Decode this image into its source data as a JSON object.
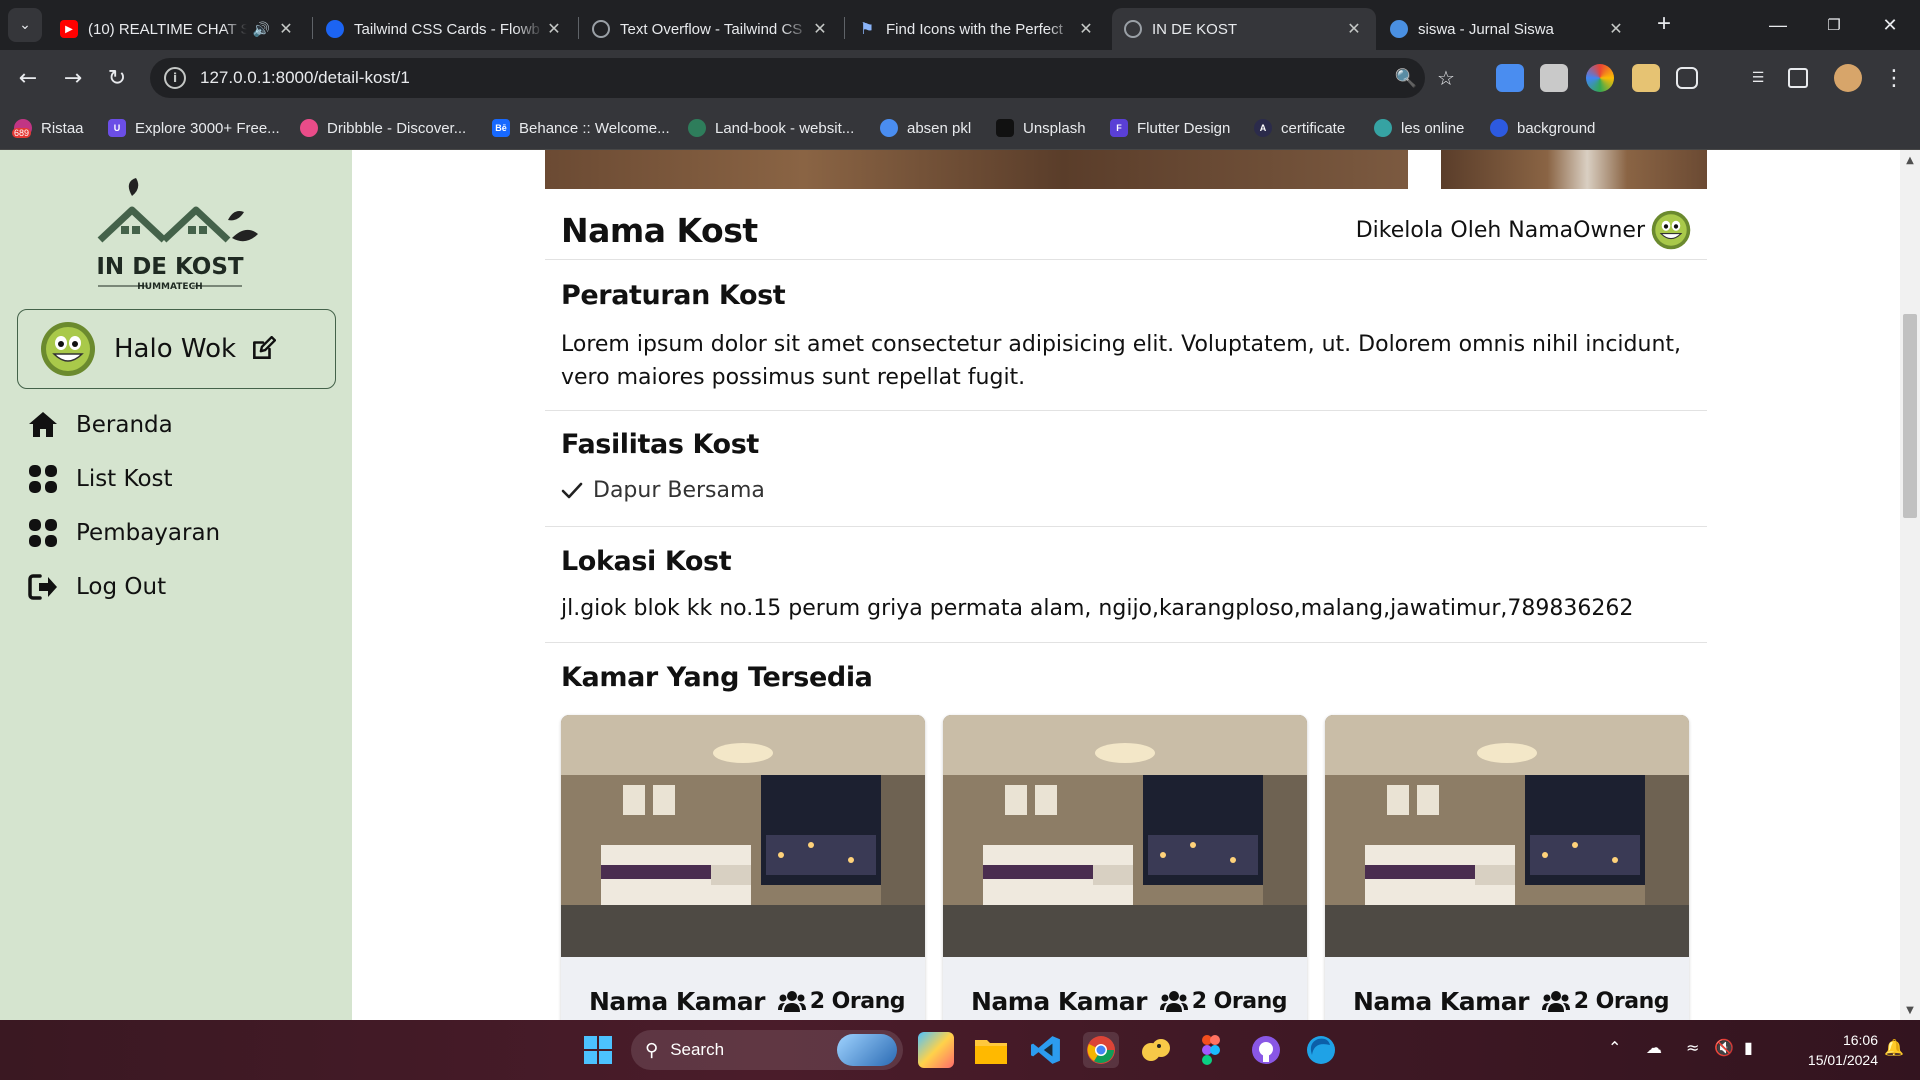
{
  "browser": {
    "tabs": [
      {
        "title": "(10) REALTIME CHAT S",
        "color": "#ff0000"
      },
      {
        "title": "Tailwind CSS Cards - Flowb",
        "color": "#1c64f2"
      },
      {
        "title": "Text Overflow - Tailwind CS",
        "color": "#9aa0a6"
      },
      {
        "title": "Find Icons with the Perfect",
        "color": "#8ab4f8"
      },
      {
        "title": "IN DE KOST",
        "color": "#9aa0a6"
      },
      {
        "title": "siswa - Jurnal Siswa",
        "color": "#4a90e2"
      }
    ],
    "url": "127.0.0.1:8000/detail-kost/1",
    "bookmarks": [
      {
        "label": "Ristaa",
        "color": "#c13584"
      },
      {
        "label": "Explore 3000+ Free...",
        "color": "#6b4ee6"
      },
      {
        "label": "Dribbble - Discover...",
        "color": "#ea4c89"
      },
      {
        "label": "Behance :: Welcome...",
        "color": "#1769ff"
      },
      {
        "label": "Land-book - websit...",
        "color": "#2e7d5b"
      },
      {
        "label": "absen pkl",
        "color": "#4a8df0"
      },
      {
        "label": "Unsplash",
        "color": "#111111"
      },
      {
        "label": "Flutter Design",
        "color": "#5a3fd6"
      },
      {
        "label": "certificate",
        "color": "#2b2b4b"
      },
      {
        "label": "les online",
        "color": "#36a3a3"
      },
      {
        "label": "background",
        "color": "#2d5ae0"
      }
    ],
    "bookmark_badge": "689"
  },
  "sidebar": {
    "logo_text": "IN DE KOST",
    "logo_sub": "HUMMATECH",
    "greeting": "Halo Wok",
    "items": [
      {
        "label": "Beranda",
        "icon": "house-icon"
      },
      {
        "label": "List Kost",
        "icon": "grid-icon"
      },
      {
        "label": "Pembayaran",
        "icon": "grid-icon"
      },
      {
        "label": "Log Out",
        "icon": "logout-icon"
      }
    ]
  },
  "kost": {
    "name": "Nama Kost",
    "owner": "Dikelola Oleh NamaOwner",
    "rules_title": "Peraturan Kost",
    "rules_text": "Lorem ipsum dolor sit amet consectetur adipisicing elit. Voluptatem, ut. Dolorem omnis nihil incidunt, vero maiores possimus sunt repellat fugit.",
    "facilities_title": "Fasilitas Kost",
    "facilities": [
      "Dapur Bersama"
    ],
    "location_title": "Lokasi Kost",
    "location_text": "jl.giok blok kk no.15 perum griya permata alam, ngijo,karangploso,malang,jawatimur,789836262",
    "rooms_title": "Kamar Yang Tersedia",
    "rooms": [
      {
        "name": "Nama Kamar",
        "capacity": "2 Orang"
      },
      {
        "name": "Nama Kamar",
        "capacity": "2 Orang"
      },
      {
        "name": "Nama Kamar",
        "capacity": "2 Orang"
      }
    ]
  },
  "taskbar": {
    "search_label": "Search",
    "time": "16:06",
    "date": "15/01/2024"
  },
  "colors": {
    "sidebar_bg": "#d5e4cf",
    "sidebar_accent": "#44624a"
  }
}
